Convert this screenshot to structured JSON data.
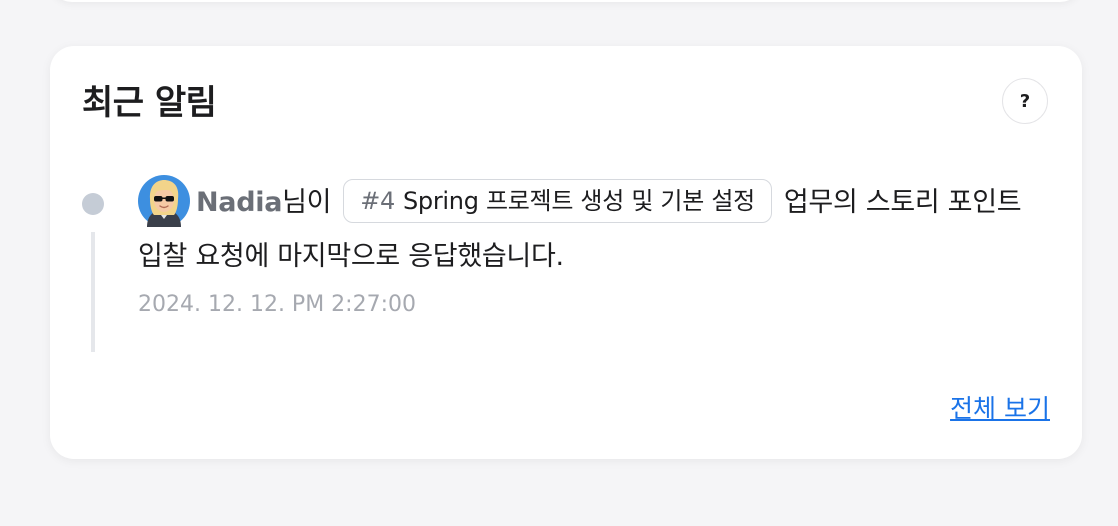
{
  "card": {
    "title": "최근 알림",
    "help_label": "?",
    "view_all_label": "전체 보기"
  },
  "notifications": [
    {
      "user_name": "Nadia",
      "user_suffix": "님이",
      "ticket_number": "#4",
      "ticket_title": "Spring 프로젝트 생성 및 기본 설정",
      "message_rest": "업무의 스토리 포인트 입찰 요청에 마지막으로 응답했습니다.",
      "timestamp": "2024. 12. 12. PM 2:27:00",
      "avatar_icon": "memoji-avatar-icon"
    }
  ],
  "colors": {
    "background": "#f5f5f7",
    "card": "#ffffff",
    "link": "#1a73e8",
    "timeline_dot": "#c5ccd6",
    "muted_text": "#a6a9b0"
  }
}
